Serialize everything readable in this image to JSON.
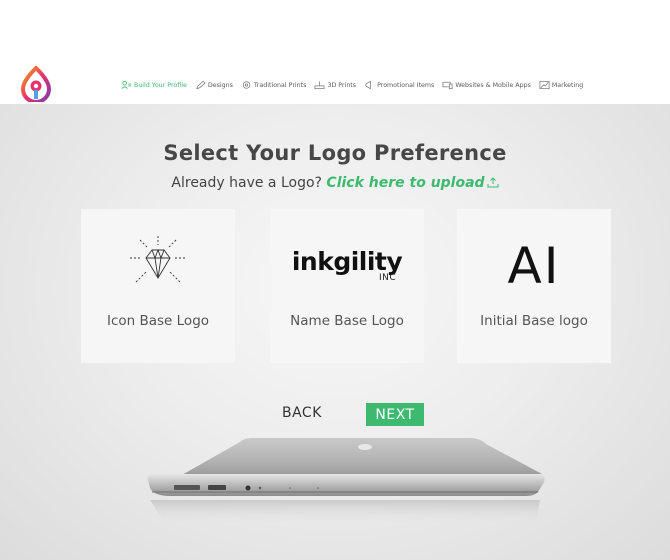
{
  "nav": {
    "items": [
      {
        "label": "Build Your Profile",
        "icon": "profile-icon"
      },
      {
        "label": "Designs",
        "icon": "pencil-icon"
      },
      {
        "label": "Traditional Prints",
        "icon": "print-icon"
      },
      {
        "label": "3D Prints",
        "icon": "3d-print-icon"
      },
      {
        "label": "Promotional Items",
        "icon": "megaphone-icon"
      },
      {
        "label": "Websites & Mobile Apps",
        "icon": "devices-icon"
      },
      {
        "label": "Marketing",
        "icon": "chart-icon"
      }
    ]
  },
  "hero": {
    "title": "Select Your Logo Preference",
    "subtitle_prefix": "Already have a Logo?",
    "upload_link": "Click here to upload"
  },
  "cards": [
    {
      "label": "Icon Base Logo",
      "icon": "diamond-icon"
    },
    {
      "label": "Name Base Logo",
      "wordmark": "inkgility",
      "wordmark_sub": "INC"
    },
    {
      "label": "Initial Base logo",
      "initials": "AI"
    }
  ],
  "actions": {
    "back": "BACK",
    "next": "NEXT"
  },
  "colors": {
    "accent": "#3dba6f",
    "text": "#474747"
  }
}
